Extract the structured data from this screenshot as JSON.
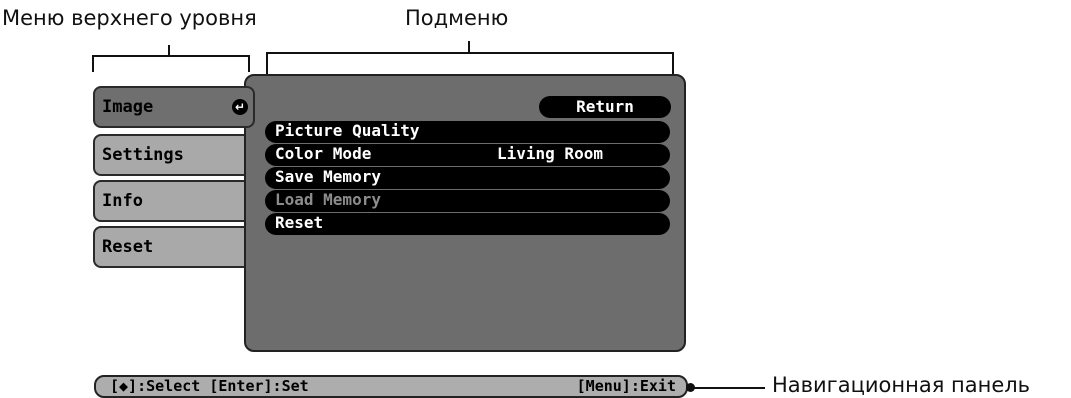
{
  "annotations": {
    "top_menu": "Меню верхнего уровня",
    "submenu": "Подменю",
    "nav_panel": "Навигационная панель"
  },
  "top_menu": {
    "items": [
      {
        "label": "Image",
        "selected": true
      },
      {
        "label": "Settings"
      },
      {
        "label": "Info"
      },
      {
        "label": "Reset"
      }
    ],
    "enter_icon": "enter-icon"
  },
  "submenu": {
    "return_label": "Return",
    "items": [
      {
        "label": "Picture Quality",
        "value": ""
      },
      {
        "label": "Color Mode",
        "value": "Living Room"
      },
      {
        "label": "Save Memory",
        "value": ""
      },
      {
        "label": "Load Memory",
        "value": "",
        "disabled": true
      },
      {
        "label": "Reset",
        "value": ""
      }
    ]
  },
  "navbar": {
    "left": "[◆]:Select [Enter]:Set",
    "right": "[Menu]:Exit"
  },
  "colors": {
    "panel": "#6d6d6d",
    "menu_item": "#a9a9a9",
    "menu_item_selected": "#6f6f6f",
    "row": "#000000",
    "navbar": "#adadad"
  }
}
